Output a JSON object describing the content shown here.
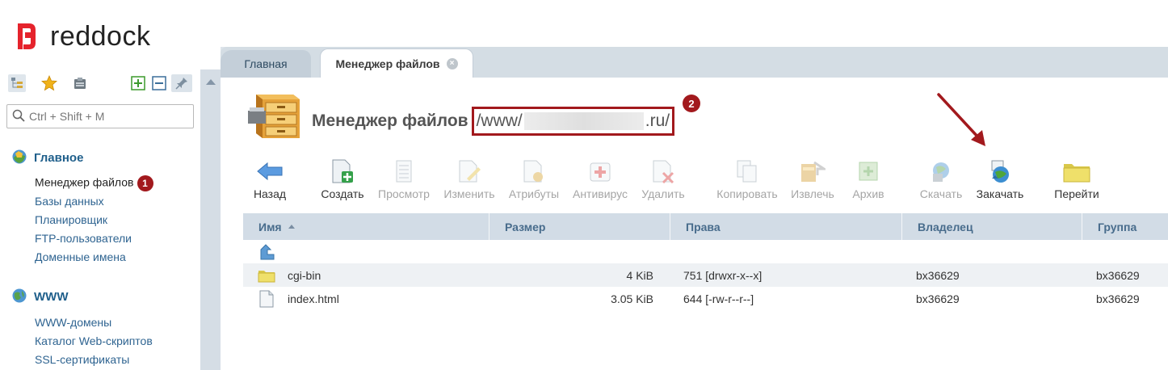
{
  "brand": {
    "name": "reddock",
    "color": "#e5232c"
  },
  "sidebar": {
    "search_placeholder": "Ctrl + Shift + M",
    "tools": [
      "tree-icon",
      "star-icon",
      "clipboard-icon",
      "expand-all-icon",
      "collapse-all-icon",
      "pin-icon"
    ],
    "groups": [
      {
        "title": "Главное",
        "items": [
          "Менеджер файлов",
          "Базы данных",
          "Планировщик",
          "FTP-пользователи",
          "Доменные имена"
        ]
      },
      {
        "title": "WWW",
        "items": [
          "WWW-домены",
          "Каталог Web-скриптов",
          "SSL-сертификаты"
        ]
      }
    ],
    "active_badge": "1"
  },
  "tabs": [
    {
      "label": "Главная"
    },
    {
      "label": "Менеджер файлов"
    }
  ],
  "header": {
    "title": "Менеджер файлов",
    "path_prefix": "/www/",
    "path_suffix": ".ru/",
    "path_badge": "2"
  },
  "toolbar": [
    {
      "label": "Назад",
      "icon": "back-arrow-icon",
      "enabled": true
    },
    {
      "label": "Создать",
      "icon": "create-file-icon",
      "enabled": true
    },
    {
      "label": "Просмотр",
      "icon": "view-icon",
      "enabled": false
    },
    {
      "label": "Изменить",
      "icon": "edit-icon",
      "enabled": false
    },
    {
      "label": "Атрибуты",
      "icon": "attributes-icon",
      "enabled": false
    },
    {
      "label": "Антивирус",
      "icon": "antivirus-icon",
      "enabled": false
    },
    {
      "label": "Удалить",
      "icon": "delete-icon",
      "enabled": false
    },
    {
      "label": "Копировать",
      "icon": "copy-icon",
      "enabled": false
    },
    {
      "label": "Извлечь",
      "icon": "extract-icon",
      "enabled": false
    },
    {
      "label": "Архив",
      "icon": "archive-icon",
      "enabled": false
    },
    {
      "label": "Скачать",
      "icon": "download-icon",
      "enabled": false
    },
    {
      "label": "Закачать",
      "icon": "upload-icon",
      "enabled": true
    },
    {
      "label": "Перейти",
      "icon": "folder-goto-icon",
      "enabled": true
    }
  ],
  "table": {
    "columns": [
      "Имя",
      "Размер",
      "Права",
      "Владелец",
      "Группа"
    ],
    "rows": [
      {
        "type": "folder",
        "name": "cgi-bin",
        "size": "4 KiB",
        "perms": "751 [drwxr-x--x]",
        "owner": "bx36629",
        "group": "bx36629"
      },
      {
        "type": "file",
        "name": "index.html",
        "size": "3.05 KiB",
        "perms": "644 [-rw-r--r--]",
        "owner": "bx36629",
        "group": "bx36629"
      }
    ]
  }
}
